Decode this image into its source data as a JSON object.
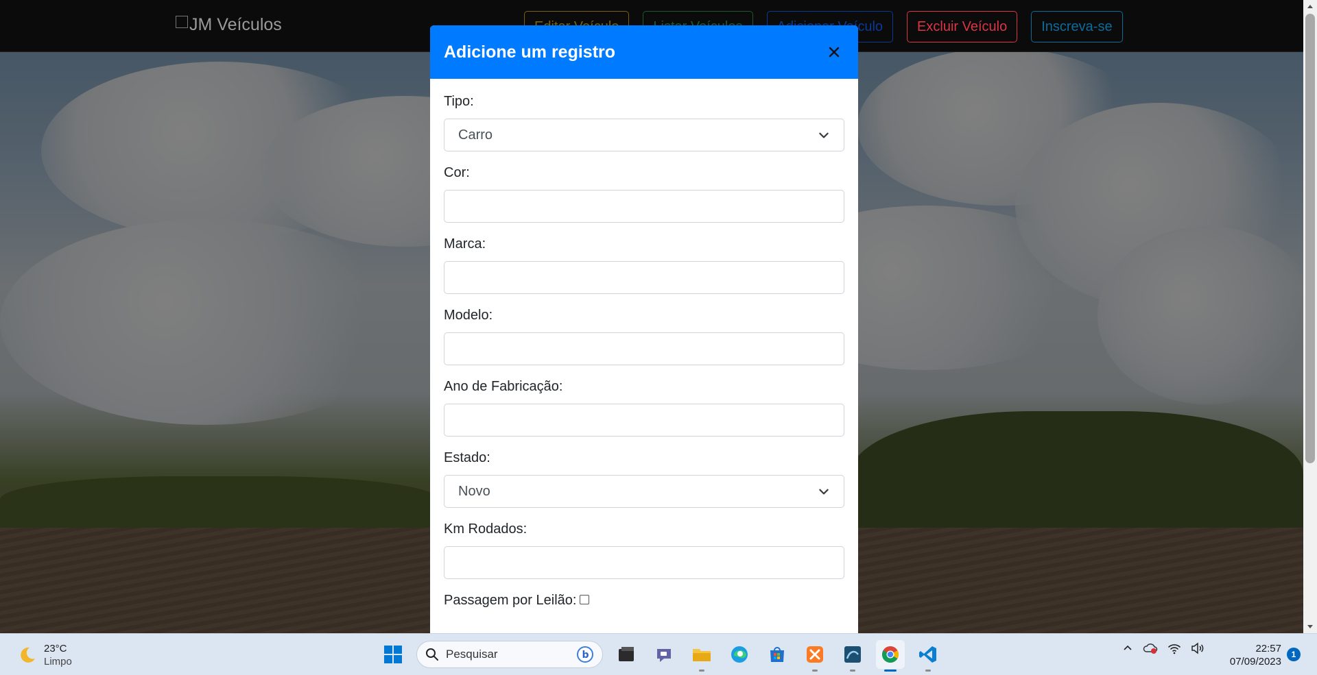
{
  "navbar": {
    "brand": "JM Veículos",
    "buttons": [
      {
        "label": "Editar Veículo"
      },
      {
        "label": "Listar Veículos"
      },
      {
        "label": "Adicionar Veículo"
      },
      {
        "label": "Excluir Veículo"
      },
      {
        "label": "Inscreva-se"
      }
    ]
  },
  "modal": {
    "title": "Adicione um registro",
    "close_label": "×",
    "fields": {
      "tipo": {
        "label": "Tipo:",
        "value": "Carro"
      },
      "cor": {
        "label": "Cor:",
        "value": ""
      },
      "marca": {
        "label": "Marca:",
        "value": ""
      },
      "modelo": {
        "label": "Modelo:",
        "value": ""
      },
      "ano": {
        "label": "Ano de Fabricação:",
        "value": ""
      },
      "estado": {
        "label": "Estado:",
        "value": "Novo"
      },
      "km": {
        "label": "Km Rodados:",
        "value": ""
      },
      "leilao": {
        "label": "Passagem por Leilão:",
        "checked": false
      }
    }
  },
  "taskbar": {
    "weather": {
      "temp": "23°C",
      "condition": "Limpo",
      "icon": "moon-icon"
    },
    "search_placeholder": "Pesquisar",
    "apps": [
      "start-icon",
      "terminal-icon",
      "teams-chat-icon",
      "file-explorer-icon",
      "edge-icon",
      "microsoft-store-icon",
      "xampp-icon",
      "mysql-workbench-icon",
      "chrome-icon",
      "vscode-icon"
    ],
    "clock": {
      "time": "22:57",
      "date": "07/09/2023"
    },
    "notification_count": "1"
  },
  "colors": {
    "modal_header": "#007bff",
    "danger": "#dc3545",
    "taskbar": "#dce6f3"
  }
}
